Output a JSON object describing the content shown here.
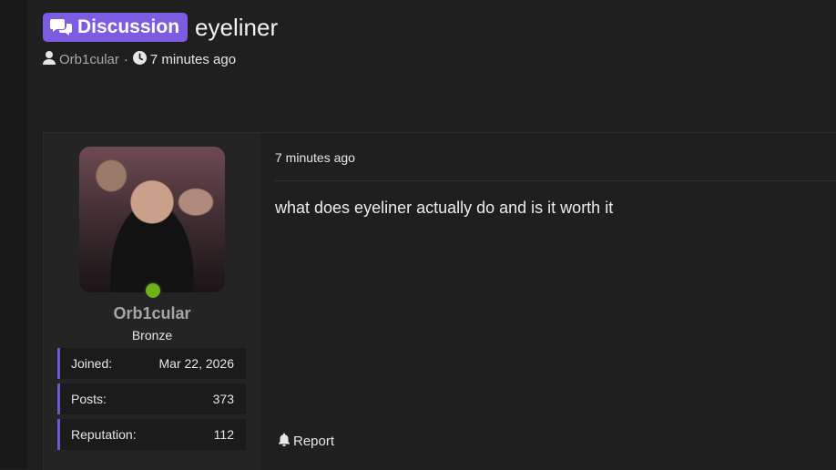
{
  "thread": {
    "prefix": "Discussion",
    "title": "eyeliner",
    "author": "Orb1cular",
    "separator": "·",
    "time": "7 minutes ago"
  },
  "post": {
    "time": "7 minutes ago",
    "body": "what does eyeliner actually do and is it worth it",
    "report_label": "Report"
  },
  "user": {
    "name": "Orb1cular",
    "rank": "Bronze",
    "online": true,
    "stats": [
      {
        "label": "Joined:",
        "value": "Mar 22, 2026"
      },
      {
        "label": "Posts:",
        "value": "373"
      },
      {
        "label": "Reputation:",
        "value": "112"
      }
    ]
  },
  "colors": {
    "accent": "#7c5ce0",
    "online": "#6cb31a",
    "stat_border": "#6a5acd"
  }
}
